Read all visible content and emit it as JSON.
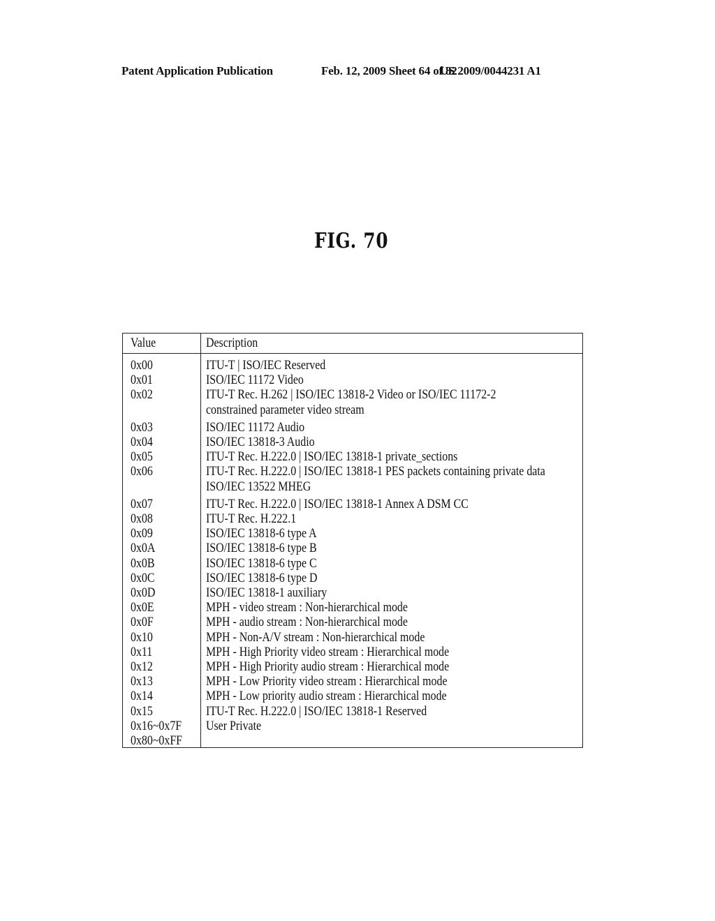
{
  "header": {
    "left": "Patent Application Publication",
    "middle": "Feb. 12, 2009  Sheet 64 of 82",
    "right": "US 2009/0044231 A1"
  },
  "figure": {
    "title": "FIG. 70"
  },
  "table": {
    "columns": [
      "Value",
      "Description"
    ],
    "rows": [
      {
        "value": "0x00",
        "description": [
          "ITU-T | ISO/IEC Reserved"
        ]
      },
      {
        "value": "0x01",
        "description": [
          "ISO/IEC 11172 Video"
        ]
      },
      {
        "value": "0x02",
        "description": [
          "ITU-T Rec. H.262 | ISO/IEC 13818-2 Video or ISO/IEC 11172-2",
          "constrained parameter video stream"
        ]
      },
      {
        "value": "0x03",
        "description": [
          "ISO/IEC 11172 Audio"
        ]
      },
      {
        "value": "0x04",
        "description": [
          "ISO/IEC 13818-3 Audio"
        ]
      },
      {
        "value": "0x05",
        "description": [
          "ITU-T Rec. H.222.0 | ISO/IEC 13818-1 private_sections"
        ]
      },
      {
        "value": "0x06",
        "description": [
          "ITU-T Rec. H.222.0 | ISO/IEC 13818-1 PES packets containing private data",
          "ISO/IEC 13522 MHEG"
        ]
      },
      {
        "value": "0x07",
        "description": [
          "ITU-T Rec. H.222.0 | ISO/IEC 13818-1 Annex A DSM CC"
        ]
      },
      {
        "value": "0x08",
        "description": [
          "ITU-T Rec. H.222.1"
        ]
      },
      {
        "value": "0x09",
        "description": [
          "ISO/IEC 13818-6 type A"
        ]
      },
      {
        "value": "0x0A",
        "description": [
          "ISO/IEC 13818-6 type B"
        ]
      },
      {
        "value": "0x0B",
        "description": [
          "ISO/IEC 13818-6 type C"
        ]
      },
      {
        "value": "0x0C",
        "description": [
          "ISO/IEC 13818-6 type D"
        ]
      },
      {
        "value": "0x0D",
        "description": [
          "ISO/IEC 13818-1 auxiliary"
        ]
      },
      {
        "value": "0x0E",
        "description": [
          "MPH - video stream : Non-hierarchical mode"
        ]
      },
      {
        "value": "0x0F",
        "description": [
          "MPH - audio stream : Non-hierarchical mode"
        ]
      },
      {
        "value": "0x10",
        "description": [
          "MPH - Non-A/V stream : Non-hierarchical mode"
        ]
      },
      {
        "value": "0x11",
        "description": [
          "MPH - High Priority video stream : Hierarchical mode"
        ]
      },
      {
        "value": "0x12",
        "description": [
          "MPH - High Priority audio stream : Hierarchical mode"
        ]
      },
      {
        "value": "0x13",
        "description": [
          "MPH - Low Priority video stream : Hierarchical mode"
        ]
      },
      {
        "value": "0x14",
        "description": [
          "MPH - Low priority audio stream : Hierarchical mode"
        ]
      },
      {
        "value": "0x15",
        "description": [
          "ITU-T Rec. H.222.0 | ISO/IEC 13818-1 Reserved"
        ]
      },
      {
        "value": "0x16~0x7F",
        "description": [
          "User Private"
        ]
      },
      {
        "value": "0x80~0xFF",
        "description": []
      }
    ]
  }
}
